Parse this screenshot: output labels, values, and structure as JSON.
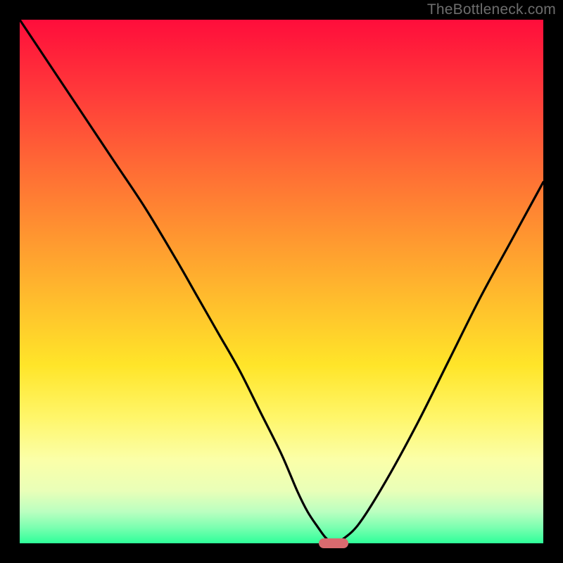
{
  "watermark": "TheBottleneck.com",
  "chart_data": {
    "type": "line",
    "title": "",
    "xlabel": "",
    "ylabel": "",
    "xlim": [
      0,
      100
    ],
    "ylim": [
      0,
      100
    ],
    "x": [
      0,
      6,
      12,
      18,
      24,
      30,
      34,
      38,
      42,
      46,
      50,
      53,
      55,
      57,
      58.5,
      60,
      62,
      65,
      70,
      76,
      82,
      88,
      94,
      100
    ],
    "y": [
      100,
      91,
      82,
      73,
      64,
      54,
      47,
      40,
      33,
      25,
      17,
      10,
      6,
      3,
      1,
      0,
      1,
      4,
      12,
      23,
      35,
      47,
      58,
      69
    ],
    "minimum_x": 60,
    "marker": {
      "x": 60,
      "y": 0
    }
  },
  "colors": {
    "curve": "#000000",
    "marker": "#d96a6f",
    "frame": "#000000"
  }
}
